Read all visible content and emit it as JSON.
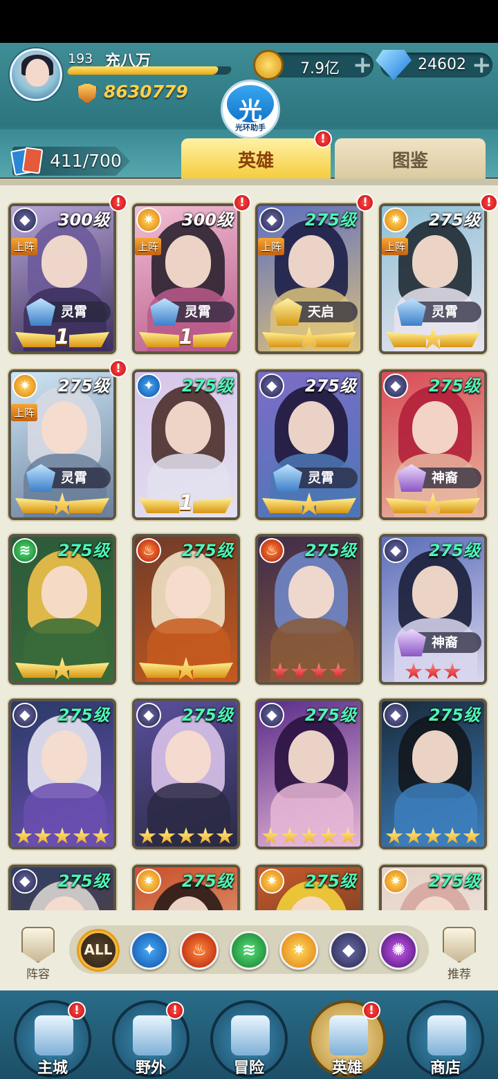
{
  "player": {
    "level": "193",
    "name": "充八万",
    "power": "8630779",
    "xp_fraction": 0.92
  },
  "resources": {
    "gold": "7.9亿",
    "diamonds": "24602",
    "plus": "+"
  },
  "helper": {
    "glyph": "光",
    "caption": "光环助手"
  },
  "hero_count": "411/700",
  "tabs": {
    "heroes": "英雄",
    "codex": "图鉴",
    "badge": "!"
  },
  "tag_on_team": "上阵",
  "heroes": [
    {
      "level": "300级",
      "elem": "dark",
      "elem_icon": "dark-element-icon",
      "on_team": true,
      "rank": "灵霄",
      "wing_num": "1",
      "badge": true,
      "level_color": "white"
    },
    {
      "level": "300级",
      "elem": "light",
      "elem_icon": "light-element-icon",
      "on_team": true,
      "rank": "灵霄",
      "wing_num": "1",
      "badge": true,
      "level_color": "white"
    },
    {
      "level": "275级",
      "elem": "dark",
      "elem_icon": "dark-element-icon",
      "on_team": true,
      "rank": "天启",
      "wing_num": "",
      "badge": true,
      "level_color": "green"
    },
    {
      "level": "275级",
      "elem": "light",
      "elem_icon": "light-element-icon",
      "on_team": true,
      "rank": "灵霄",
      "wing_num": "",
      "badge": true,
      "level_color": "white"
    },
    {
      "level": "275级",
      "elem": "light",
      "elem_icon": "light-element-icon",
      "on_team": true,
      "rank": "灵霄",
      "wing_num": "",
      "badge": true,
      "level_color": "white"
    },
    {
      "level": "275级",
      "elem": "water",
      "elem_icon": "water-element-icon",
      "on_team": false,
      "rank": "",
      "wing_num": "1",
      "badge": false,
      "level_color": "green"
    },
    {
      "level": "275级",
      "elem": "dark",
      "elem_icon": "dark-element-icon",
      "on_team": false,
      "rank": "灵霄",
      "wing_num": "",
      "badge": false,
      "level_color": "white"
    },
    {
      "level": "275级",
      "elem": "dark",
      "elem_icon": "dark-element-icon",
      "on_team": false,
      "rank": "神裔",
      "wing_num": "",
      "badge": false,
      "level_color": "green"
    },
    {
      "level": "275级",
      "elem": "wind",
      "elem_icon": "wind-element-icon",
      "on_team": false,
      "rank": "",
      "wing_num": "",
      "badge": false,
      "level_color": "green"
    },
    {
      "level": "275级",
      "elem": "fire",
      "elem_icon": "fire-element-icon",
      "on_team": false,
      "rank": "",
      "wing_num": "",
      "badge": false,
      "level_color": "green"
    },
    {
      "level": "275级",
      "elem": "fire",
      "elem_icon": "fire-element-icon",
      "on_team": false,
      "rank": "",
      "stars": 4,
      "star_color": "red",
      "badge": false,
      "level_color": "green"
    },
    {
      "level": "275级",
      "elem": "dark",
      "elem_icon": "dark-element-icon",
      "on_team": false,
      "rank": "神裔",
      "stars": 3,
      "star_color": "red",
      "badge": false,
      "level_color": "green"
    },
    {
      "level": "275级",
      "elem": "dark",
      "elem_icon": "dark-element-icon",
      "on_team": false,
      "rank": "",
      "stars": 5,
      "star_color": "gold",
      "badge": false,
      "level_color": "green"
    },
    {
      "level": "275级",
      "elem": "dark",
      "elem_icon": "dark-element-icon",
      "on_team": false,
      "rank": "",
      "stars": 5,
      "star_color": "gold",
      "badge": false,
      "level_color": "green"
    },
    {
      "level": "275级",
      "elem": "dark",
      "elem_icon": "dark-element-icon",
      "on_team": false,
      "rank": "",
      "stars": 5,
      "star_color": "gold",
      "badge": false,
      "level_color": "green"
    },
    {
      "level": "275级",
      "elem": "dark",
      "elem_icon": "dark-element-icon",
      "on_team": false,
      "rank": "",
      "stars": 5,
      "star_color": "gold",
      "badge": false,
      "level_color": "green"
    },
    {
      "level": "275级",
      "elem": "dark",
      "elem_icon": "dark-element-icon",
      "on_team": false,
      "rank": "",
      "badge": false,
      "level_color": "green"
    },
    {
      "level": "275级",
      "elem": "light",
      "elem_icon": "light-element-icon",
      "on_team": false,
      "rank": "",
      "badge": false,
      "level_color": "green"
    },
    {
      "level": "275级",
      "elem": "light",
      "elem_icon": "light-element-icon",
      "on_team": false,
      "rank": "",
      "badge": false,
      "level_color": "green"
    },
    {
      "level": "275级",
      "elem": "light",
      "elem_icon": "light-element-icon",
      "on_team": false,
      "rank": "",
      "badge": false,
      "level_color": "green"
    }
  ],
  "filters": {
    "lineup": "阵容",
    "all": "ALL",
    "recommend": "推荐",
    "elements": [
      "water-element-icon",
      "fire-element-icon",
      "wind-element-icon",
      "light-element-icon",
      "dark-element-icon",
      "chaos-element-icon"
    ]
  },
  "nav": [
    {
      "label": "主城",
      "icon": "castle-icon",
      "badge": true
    },
    {
      "label": "野外",
      "icon": "portal-icon",
      "badge": true
    },
    {
      "label": "冒险",
      "icon": "sword-icon",
      "badge": false
    },
    {
      "label": "英雄",
      "icon": "helmet-icon",
      "badge": true
    },
    {
      "label": "商店",
      "icon": "shop-icon",
      "badge": false
    }
  ],
  "colors": {
    "accent": "#f4cb3a",
    "level_green": "#4ef5b6",
    "badge_red": "#d81b1b"
  }
}
